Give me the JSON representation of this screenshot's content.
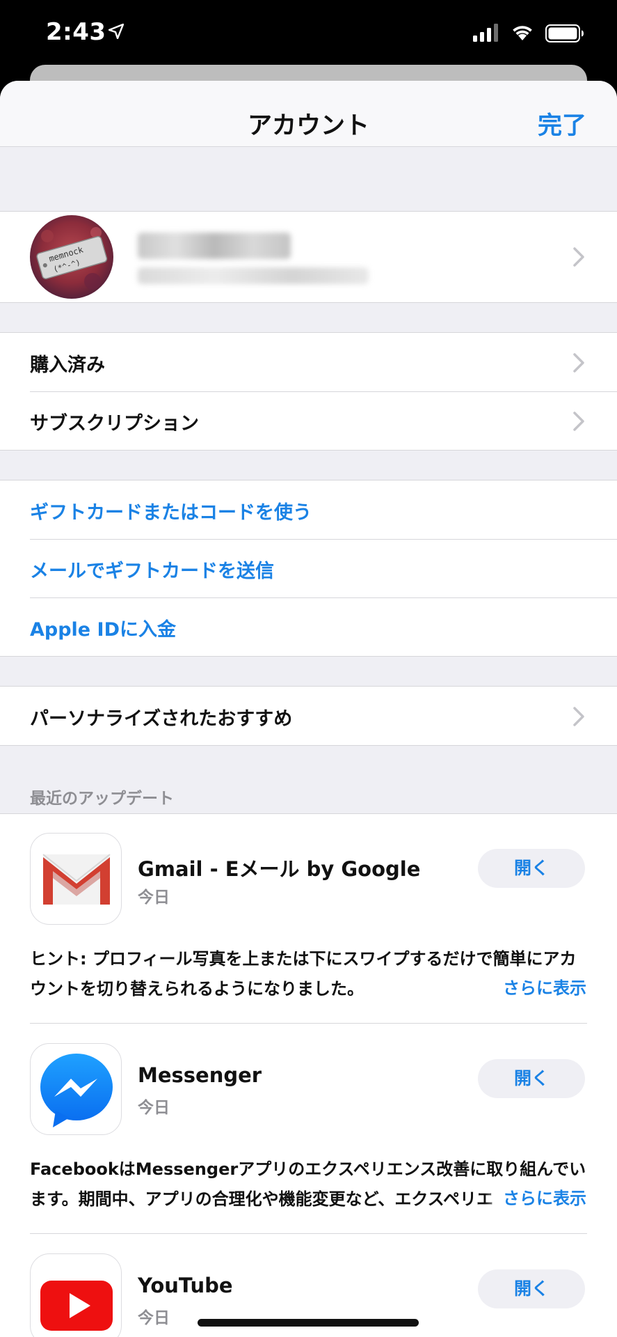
{
  "status_bar": {
    "time": "2:43"
  },
  "nav": {
    "title": "アカウント",
    "done": "完了"
  },
  "purchases": [
    {
      "label": "購入済み"
    },
    {
      "label": "サブスクリプション"
    }
  ],
  "gift": [
    {
      "label": "ギフトカードまたはコードを使う"
    },
    {
      "label": "メールでギフトカードを送信"
    },
    {
      "label": "Apple IDに入金"
    }
  ],
  "personalized": {
    "label": "パーソナライズされたおすすめ"
  },
  "updates": {
    "header": "最近のアップデート",
    "more_label": "さらに表示",
    "apps": [
      {
        "name": "Gmail - Eメール by Google",
        "date": "今日",
        "button": "開く",
        "icon": "gmail-icon",
        "notes": "ヒント: プロフィール写真を上または下にスワイプするだけで簡単にアカウントを切り替えられるようになりました。"
      },
      {
        "name": "Messenger",
        "date": "今日",
        "button": "開く",
        "icon": "messenger-icon",
        "notes": "FacebookはMessengerアプリのエクスペリエンス改善に取り組んでいます。期間中、アプリの合理化や機能変更など、エクスペリエ"
      },
      {
        "name": "YouTube",
        "date": "今日",
        "button": "開く",
        "icon": "youtube-icon"
      }
    ]
  },
  "colors": {
    "accent": "#1a82e5",
    "background": "#efeff4"
  }
}
